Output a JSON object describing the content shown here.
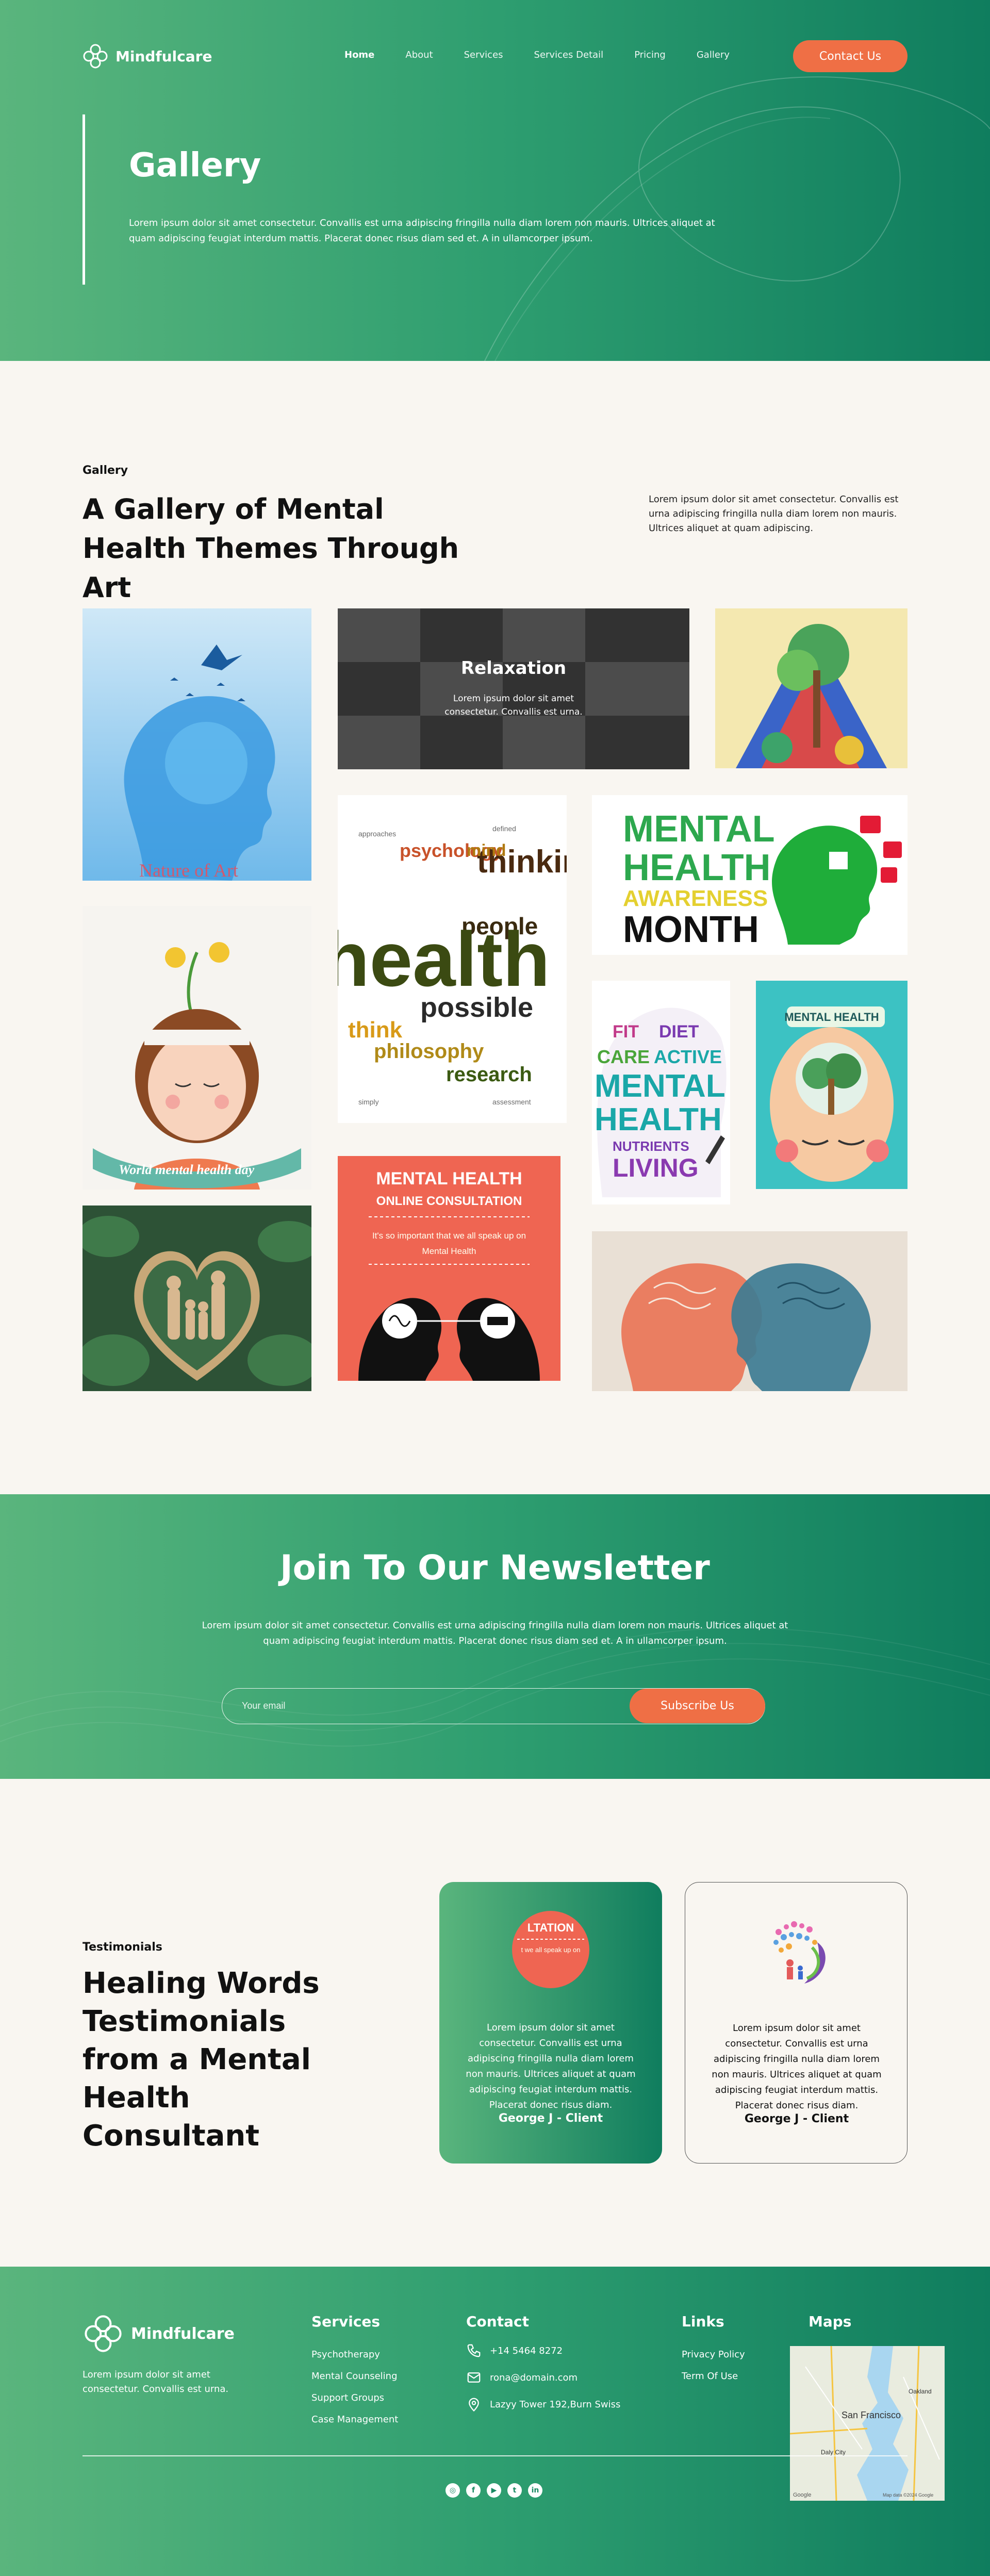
{
  "brand": {
    "name": "Mindfulcare"
  },
  "nav": {
    "items": [
      {
        "label": "Home"
      },
      {
        "label": "About"
      },
      {
        "label": "Services"
      },
      {
        "label": "Services Detail"
      },
      {
        "label": "Pricing"
      },
      {
        "label": "Gallery"
      }
    ],
    "cta": "Contact Us"
  },
  "hero": {
    "title": "Gallery",
    "description": "Lorem ipsum dolor sit amet consectetur. Convallis est urna adipiscing fringilla nulla diam lorem non mauris. Ultrices aliquet at quam adipiscing feugiat interdum mattis. Placerat donec risus diam sed et. A in ullamcorper ipsum."
  },
  "gallery": {
    "eyebrow": "Gallery",
    "heading": "A Gallery of Mental Health Themes Through Art",
    "side_text": "Lorem ipsum dolor sit amet consectetur. Convallis est urna adipiscing fringilla nulla diam lorem non mauris. Ultrices aliquet at quam adipiscing.",
    "featured": {
      "title": "Relaxation",
      "text": "Lorem ipsum dolor sit amet consectetur. Convallis est urna."
    },
    "img_texts": {
      "nature_art": "Nature of Art",
      "world_day": "World mental health day",
      "awareness_1": "MENTAL",
      "awareness_2": "HEALTH",
      "awareness_3": "AWARENESS",
      "awareness_4": "MONTH",
      "consult_1": "MENTAL HEALTH",
      "consult_2": "ONLINE CONSULTATION",
      "consult_3": "It's so important that we all speak up on",
      "consult_4": "Mental Health",
      "poster_title": "MENTAL HEALTH",
      "cloud_1": "health",
      "cloud_2": "thinking",
      "cloud_3": "possible",
      "cloud_4": "research",
      "cloud_5": "people",
      "cloud_6": "philosophy",
      "cloud_7": "psychology",
      "cloud_8": "think",
      "cloud_9": "mind",
      "head_1": "CARE",
      "head_2": "ACTIVE",
      "head_3": "MENTAL",
      "head_4": "HEALTH",
      "head_5": "LIVING",
      "head_6": "NUTRIENTS",
      "head_7": "DIET",
      "head_8": "FIT"
    }
  },
  "newsletter": {
    "title": "Join To Our Newsletter",
    "description": "Lorem ipsum dolor sit amet consectetur. Convallis est urna adipiscing fringilla nulla diam lorem non mauris. Ultrices aliquet at quam adipiscing feugiat interdum mattis. Placerat donec risus diam sed et. A in ullamcorper ipsum.",
    "placeholder": "Your email",
    "button": "Subscribe Us"
  },
  "testimonials": {
    "eyebrow": "Testimonials",
    "heading": "Healing Words Testimonials from a Mental Health Consultant",
    "cards": [
      {
        "text": "Lorem ipsum dolor sit amet consectetur. Convallis est urna adipiscing fringilla nulla diam lorem non mauris. Ultrices aliquet at quam adipiscing feugiat interdum mattis. Placerat donec risus diam.",
        "name": "George J - Client",
        "img_top": "LTATION",
        "img_bottom": "t we all speak up on"
      },
      {
        "text": "Lorem ipsum dolor sit amet consectetur. Convallis est urna adipiscing fringilla nulla diam lorem non mauris. Ultrices aliquet at quam adipiscing feugiat interdum mattis. Placerat donec risus diam.",
        "name": "George J - Client"
      }
    ]
  },
  "footer": {
    "tagline": "Lorem ipsum dolor sit amet consectetur. Convallis est urna.",
    "services": {
      "title": "Services",
      "items": [
        "Psychotherapy",
        "Mental Counseling",
        "Support Groups",
        "Case Management"
      ]
    },
    "contact": {
      "title": "Contact",
      "phone": "+14 5464 8272",
      "email": "rona@domain.com",
      "address": "Lazyy Tower 192,Burn Swiss"
    },
    "links": {
      "title": "Links",
      "items": [
        "Privacy Policy",
        "Term Of Use"
      ]
    },
    "maps": {
      "title": "Maps",
      "city": "San Francisco",
      "label_a": "Oakland",
      "label_b": "Daly City",
      "label_c": "Google",
      "label_d": "Map data ©2024 Google"
    },
    "social": [
      "instagram-icon",
      "facebook-icon",
      "youtube-icon",
      "twitter-icon",
      "linkedin-icon"
    ]
  },
  "colors": {
    "green_light": "#5ab57d",
    "green_dark": "#0f7d5e",
    "accent": "#ef6f45",
    "cream": "#f9f6f1"
  }
}
